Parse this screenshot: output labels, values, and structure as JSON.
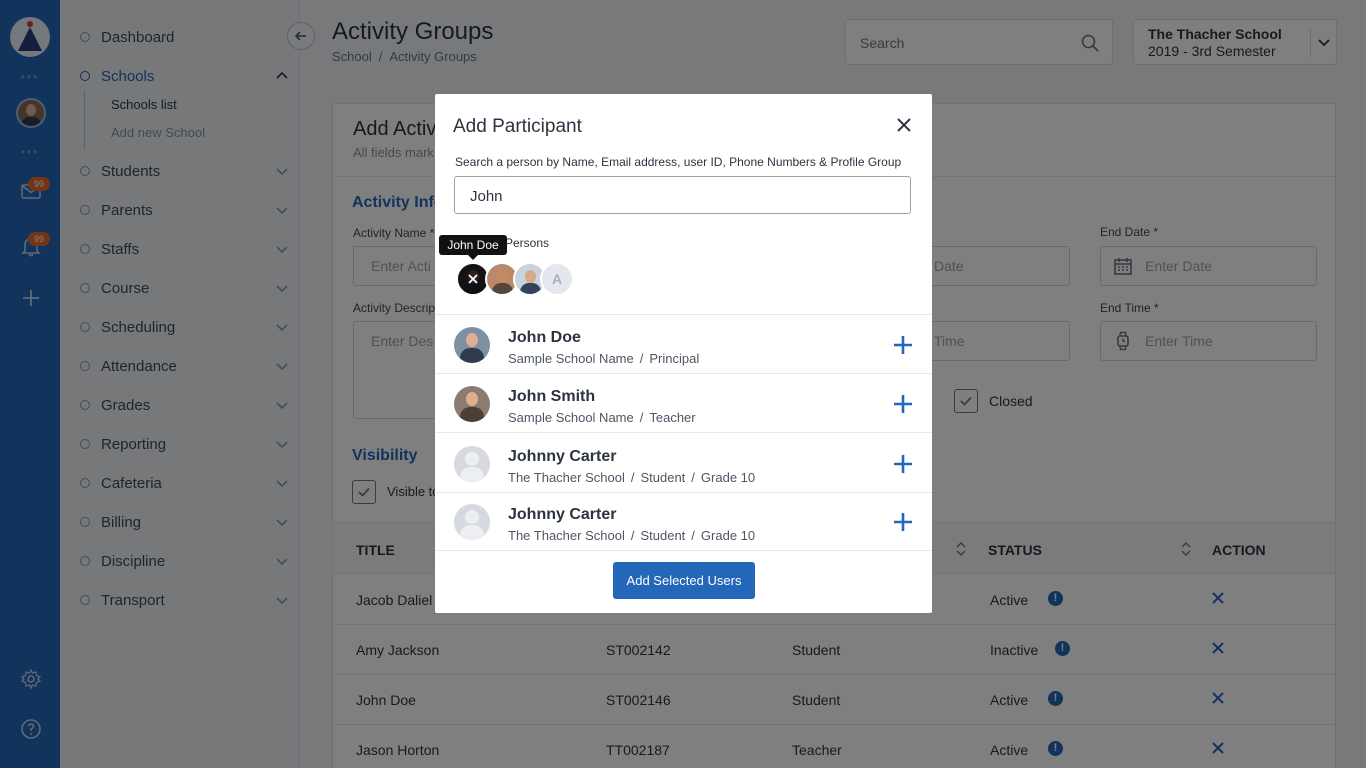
{
  "rail": {
    "dots": "•••",
    "mail_badge": "99",
    "bell_badge": "99"
  },
  "sidebar": {
    "items": [
      {
        "label": "Dashboard"
      },
      {
        "label": "Schools"
      },
      {
        "label": "Students"
      },
      {
        "label": "Parents"
      },
      {
        "label": "Staffs"
      },
      {
        "label": "Course"
      },
      {
        "label": "Scheduling"
      },
      {
        "label": "Attendance"
      },
      {
        "label": "Grades"
      },
      {
        "label": "Reporting"
      },
      {
        "label": "Cafeteria"
      },
      {
        "label": "Billing"
      },
      {
        "label": "Discipline"
      },
      {
        "label": "Transport"
      }
    ],
    "sub_items": [
      "Schools list",
      "Add new School"
    ]
  },
  "header": {
    "title": "Activity Groups",
    "breadcrumb": [
      "School",
      "Activity Groups"
    ],
    "breadcrumb_sep": "/",
    "search_placeholder": "Search",
    "school_name": "The Thacher School",
    "semester": "2019 - 3rd Semester"
  },
  "form": {
    "title_partial": "Add Activ",
    "subtitle_partial": "All fields mark",
    "section_info": "Activity Info",
    "activity_name_label": "Activity Name *",
    "activity_name_placeholder": "Enter Acti",
    "description_label": "Activity Descrip",
    "description_placeholder": "Enter Des",
    "start_date_placeholder_partial": "Date",
    "start_time_placeholder_partial": "Time",
    "end_date_label": "End Date *",
    "end_date_placeholder": "Enter Date",
    "end_time_label": "End Time *",
    "end_time_placeholder": "Enter Time",
    "closed_label": "Closed",
    "section_visibility": "Visibility",
    "visible_label_partial": "Visible to"
  },
  "table": {
    "headers": {
      "title": "TITLE",
      "status": "STATUS",
      "action": "ACTION"
    },
    "rows": [
      {
        "title": "Jacob Daliel",
        "id": "",
        "type": "",
        "status": "Active"
      },
      {
        "title": "Amy Jackson",
        "id": "ST002142",
        "type": "Student",
        "status": "Inactive"
      },
      {
        "title": "John Doe",
        "id": "ST002146",
        "type": "Student",
        "status": "Active"
      },
      {
        "title": "Jason Horton",
        "id": "TT002187",
        "type": "Teacher",
        "status": "Active"
      }
    ],
    "info_glyph": "!"
  },
  "modal": {
    "title": "Add Participant",
    "hint": "Search a person by Name, Email address, user ID, Phone Numbers  & Profile Group",
    "search_value": "John",
    "selected_label_partial": "Persons",
    "tooltip": "John Doe",
    "chip_letter": "A",
    "results": [
      {
        "name": "John Doe",
        "meta": [
          "Sample School Name",
          "Principal"
        ],
        "avatar": "photo"
      },
      {
        "name": "John Smith",
        "meta": [
          "Sample School Name",
          "Teacher"
        ],
        "avatar": "photo"
      },
      {
        "name": "Johnny Carter",
        "meta": [
          "The Thacher School",
          "Student",
          "Grade 10"
        ],
        "avatar": "blank"
      },
      {
        "name": "Johnny Carter",
        "meta": [
          "The Thacher School",
          "Student",
          "Grade 10"
        ],
        "avatar": "blank"
      }
    ],
    "meta_sep": "/",
    "add_button": "Add Selected Users"
  },
  "colors": {
    "primary": "#2466b8",
    "badge": "#e8682c",
    "sidebar_bg": "#eef0f3"
  },
  "icons": [
    "home-logo-icon",
    "mail-icon",
    "bell-icon",
    "plus-icon",
    "gear-icon",
    "help-icon",
    "search-icon",
    "chevron-down-icon",
    "chevron-up-icon",
    "arrow-left-icon",
    "close-icon",
    "calendar-icon",
    "watch-icon",
    "check-icon",
    "sort-icon",
    "add-icon"
  ]
}
